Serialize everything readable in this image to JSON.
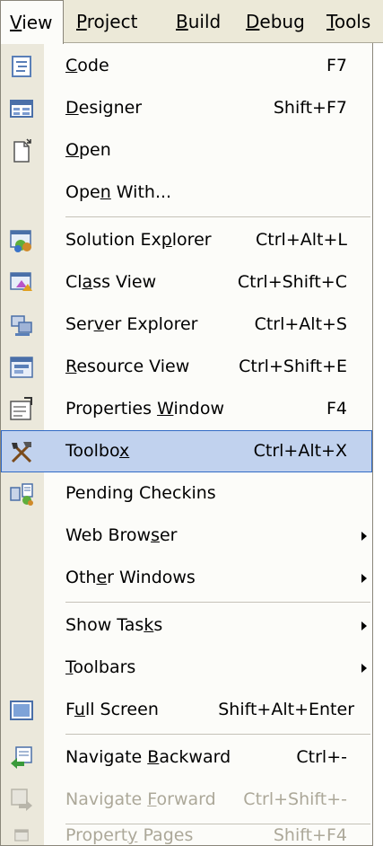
{
  "menubar": {
    "items": [
      {
        "pre": "",
        "key": "V",
        "post": "iew"
      },
      {
        "pre": "",
        "key": "P",
        "post": "roject"
      },
      {
        "pre": "",
        "key": "B",
        "post": "uild"
      },
      {
        "pre": "",
        "key": "D",
        "post": "ebug"
      },
      {
        "pre": "",
        "key": "T",
        "post": "ools"
      }
    ]
  },
  "menu": {
    "items": [
      {
        "pre": "",
        "key": "C",
        "post": "ode",
        "accel": "F7",
        "icon": "code-icon"
      },
      {
        "pre": "",
        "key": "D",
        "post": "esigner",
        "accel": "Shift+F7",
        "icon": "designer-icon"
      },
      {
        "pre": "",
        "key": "O",
        "post": "pen",
        "accel": "",
        "icon": "open-icon"
      },
      {
        "pre": "Ope",
        "key": "n",
        "post": " With...",
        "accel": "",
        "icon": ""
      },
      {
        "pre": "Solution Ex",
        "key": "p",
        "post": "lorer",
        "accel": "Ctrl+Alt+L",
        "icon": "solution-explorer-icon"
      },
      {
        "pre": "Cl",
        "key": "a",
        "post": "ss View",
        "accel": "Ctrl+Shift+C",
        "icon": "class-view-icon"
      },
      {
        "pre": "Ser",
        "key": "v",
        "post": "er Explorer",
        "accel": "Ctrl+Alt+S",
        "icon": "server-explorer-icon"
      },
      {
        "pre": "",
        "key": "R",
        "post": "esource View",
        "accel": "Ctrl+Shift+E",
        "icon": "resource-view-icon"
      },
      {
        "pre": "Properties ",
        "key": "W",
        "post": "indow",
        "accel": "F4",
        "icon": "properties-window-icon"
      },
      {
        "pre": "Toolbo",
        "key": "x",
        "post": "",
        "accel": "Ctrl+Alt+X",
        "icon": "toolbox-icon"
      },
      {
        "pre": "Pending Checkins",
        "key": "",
        "post": "",
        "accel": "",
        "icon": "pending-checkins-icon"
      },
      {
        "pre": "Web Brow",
        "key": "s",
        "post": "er",
        "accel": "",
        "icon": ""
      },
      {
        "pre": "Oth",
        "key": "e",
        "post": "r Windows",
        "accel": "",
        "icon": ""
      },
      {
        "pre": "Show Tas",
        "key": "k",
        "post": "s",
        "accel": "",
        "icon": ""
      },
      {
        "pre": "",
        "key": "T",
        "post": "oolbars",
        "accel": "",
        "icon": ""
      },
      {
        "pre": "F",
        "key": "u",
        "post": "ll Screen",
        "accel": "Shift+Alt+Enter",
        "icon": "full-screen-icon"
      },
      {
        "pre": "Navigate ",
        "key": "B",
        "post": "ackward",
        "accel": "Ctrl+-",
        "icon": "navigate-backward-icon"
      },
      {
        "pre": "Navigate ",
        "key": "F",
        "post": "orward",
        "accel": "Ctrl+Shift+-",
        "icon": "navigate-forward-icon"
      },
      {
        "pre": "Propert",
        "key": "y",
        "post": " Pages",
        "accel": "Shift+F4",
        "icon": "property-pages-icon"
      }
    ]
  },
  "colors": {
    "highlight_bg": "#c1d2ee",
    "highlight_border": "#316ac5",
    "disabled_text": "#aca899",
    "menubar_bg": "#ece9d8",
    "gutter_bg": "#ebe8db"
  }
}
